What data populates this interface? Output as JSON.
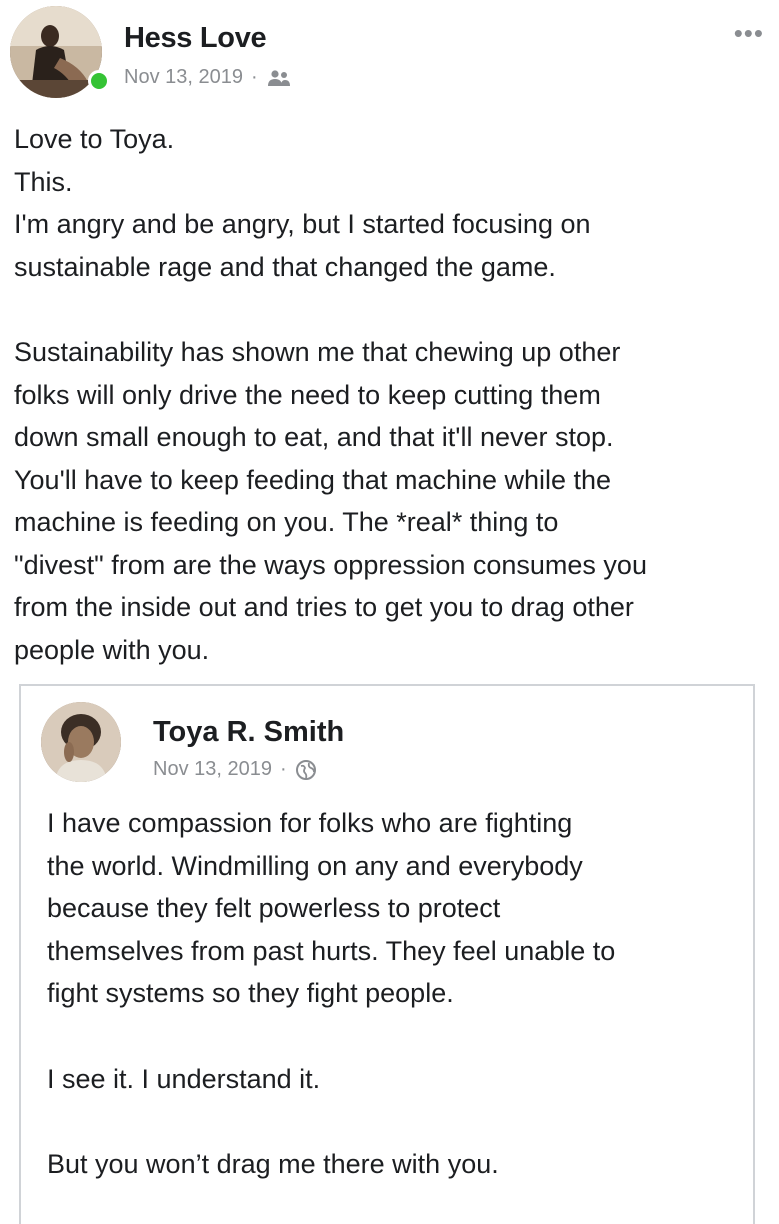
{
  "post": {
    "author": "Hess Love",
    "date": "Nov 13, 2019",
    "separator": "·",
    "audience_icon": "friends-icon",
    "more_label": "•••",
    "online_status_color": "#35c335",
    "body": [
      [
        "Love to Toya.",
        "This.",
        "I'm angry and be angry, but I started focusing on",
        "sustainable rage and that changed the game."
      ],
      [
        "Sustainability has shown me that chewing up other",
        "folks  will only drive the need to keep cutting them",
        "down small enough to eat, and that it'll never stop.",
        "You'll have to keep feeding that machine while the",
        "machine is feeding on you. The *real* thing to",
        "\"divest\" from are the ways oppression consumes you",
        "from the inside out and tries to get you to drag other",
        "people with you."
      ]
    ]
  },
  "shared_post": {
    "author": "Toya R. Smith",
    "date": "Nov 13, 2019",
    "separator": "·",
    "audience_icon": "globe-icon",
    "body": [
      [
        "I have compassion for folks who are fighting",
        "the world. Windmilling on any and everybody",
        "because they felt powerless to protect",
        "themselves from past hurts. They feel unable to",
        "fight systems so they fight people."
      ],
      [
        "I see it. I understand it."
      ],
      [
        "But you won’t drag me there with you."
      ]
    ]
  }
}
